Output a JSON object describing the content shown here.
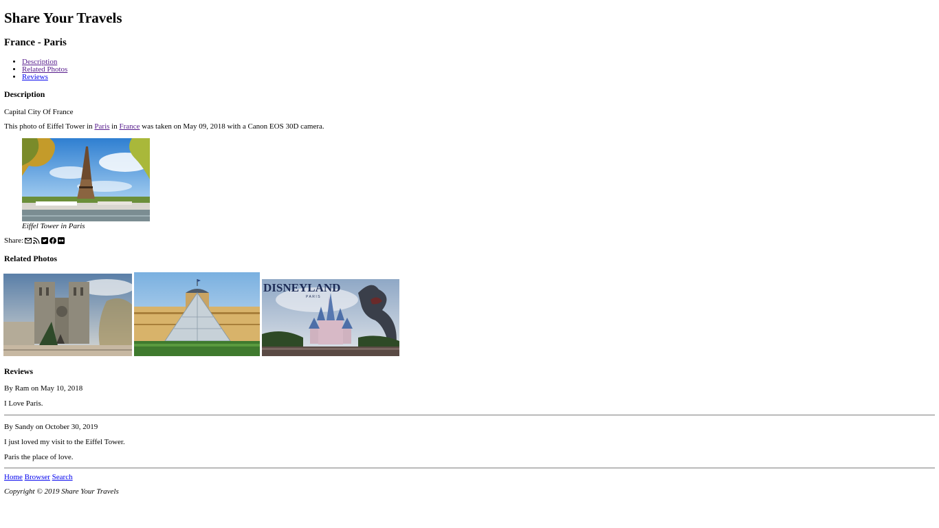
{
  "site_title": "Share Your Travels",
  "page_heading": "France - Paris",
  "nav": {
    "items": [
      {
        "label": "Description"
      },
      {
        "label": "Related Photos"
      },
      {
        "label": "Reviews"
      }
    ]
  },
  "description": {
    "heading": "Description",
    "subtitle": "Capital City Of France",
    "sentence": {
      "prefix": "This photo of Eiffel Tower in ",
      "city_link": "Paris",
      "middle": " in ",
      "country_link": "France",
      "suffix": " was taken on May 09, 2018 with a Canon EOS 30D camera."
    },
    "caption": "Eiffel Tower in Paris"
  },
  "share": {
    "label": "Share:",
    "icons": [
      "envelope-icon",
      "rss-icon",
      "twitter-icon",
      "facebook-icon",
      "flickr-icon"
    ]
  },
  "related": {
    "heading": "Related Photos",
    "logo_text": "DISNEYLAND",
    "logo_sub": "PARIS"
  },
  "reviews": {
    "heading": "Reviews",
    "items": [
      {
        "byline": "By Ram on May 10, 2018",
        "lines": [
          "I Love Paris."
        ]
      },
      {
        "byline": "By Sandy on October 30, 2019",
        "lines": [
          "I just loved my visit to the Eiffel Tower.",
          "Paris the place of love."
        ]
      }
    ]
  },
  "footer": {
    "links": [
      "Home",
      "Browser",
      "Search"
    ],
    "copyright": "Copyright © 2019 Share Your Travels"
  },
  "colors": {
    "link": "#0000ee",
    "visited_link": "#551a8b",
    "rule": "#999999"
  }
}
